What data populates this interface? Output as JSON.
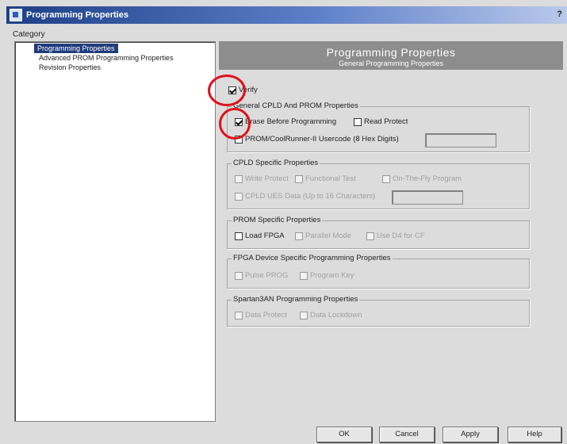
{
  "window": {
    "title": "Programming Properties",
    "help": "?"
  },
  "category": {
    "label": "Category",
    "items": [
      {
        "label": "Programming Properties",
        "selected": true
      },
      {
        "label": "Advanced PROM Programming Properties",
        "selected": false
      },
      {
        "label": "Revision Properties",
        "selected": false
      }
    ]
  },
  "header": {
    "title": "Programming Properties",
    "subtitle": "General Programming Properties"
  },
  "verify": {
    "label": "Verify",
    "checked": true
  },
  "groups": {
    "general": {
      "title": "General CPLD And PROM Properties",
      "erase": {
        "label": "Erase Before Programming",
        "checked": true
      },
      "read_protect": {
        "label": "Read Protect",
        "checked": false
      },
      "usercode": {
        "label": "PROM/CoolRunner-II Usercode (8 Hex Digits)",
        "checked": false,
        "value": ""
      }
    },
    "cpld": {
      "title": "CPLD Specific Properties",
      "write_protect": {
        "label": "Write Protect",
        "checked": false
      },
      "functional_test": {
        "label": "Functional Test",
        "checked": false
      },
      "on_the_fly": {
        "label": "On-The-Fly Program",
        "checked": false
      },
      "ues": {
        "label": "CPLD UES Data (Up to 16 Characters)",
        "checked": false,
        "value": ""
      }
    },
    "prom": {
      "title": "PROM Specific Properties",
      "load_fpga": {
        "label": "Load FPGA",
        "checked": false
      },
      "parallel_mode": {
        "label": "Parallel Mode",
        "checked": false
      },
      "use_d4": {
        "label": "Use D4 for CF",
        "checked": false
      }
    },
    "fpga": {
      "title": "FPGA Device Specific Programming Properties",
      "pulse_prog": {
        "label": "Pulse PROG",
        "checked": false
      },
      "program_key": {
        "label": "Program Key",
        "checked": false
      }
    },
    "spartan": {
      "title": "Spartan3AN Programming Properties",
      "data_protect": {
        "label": "Data Protect",
        "checked": false
      },
      "data_lockdown": {
        "label": "Data Lockdown",
        "checked": false
      }
    }
  },
  "buttons": {
    "ok": "OK",
    "cancel": "Cancel",
    "apply": "Apply",
    "help": "Help"
  },
  "colors": {
    "highlight_circle": "#e0101a",
    "selection": "#1f3b7b",
    "header_bg": "#8d8d8d"
  }
}
